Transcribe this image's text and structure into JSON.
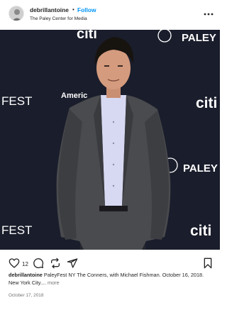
{
  "post": {
    "username": "debrillantoine",
    "separator": "•",
    "follow_label": "Follow",
    "location": "The Paley Center for Media",
    "like_count": "12",
    "caption": {
      "username": "debrillantoine",
      "text": "PaleyFest NY The Conners, with Michael Fishman. October 16, 2018. New York City....",
      "more_label": "more"
    },
    "date": "October 17, 2018"
  },
  "backdrop_text": {
    "fest": "FEST",
    "citi": "citi",
    "paley": "PALEY",
    "american": "Americ"
  },
  "colors": {
    "follow": "#0095f6",
    "backdrop": "#1a1d2b",
    "suit": "#4a4b4e",
    "shirt": "#d7d9f2"
  },
  "icons": [
    "more-icon",
    "heart-icon",
    "comment-icon",
    "repost-icon",
    "share-icon",
    "bookmark-icon"
  ]
}
